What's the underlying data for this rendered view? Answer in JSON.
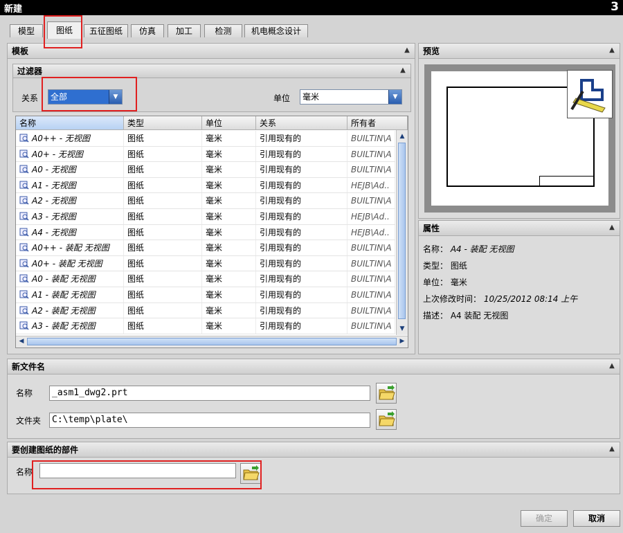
{
  "window": {
    "title": "新建",
    "close_label": "3"
  },
  "tabs": [
    {
      "label": "模型"
    },
    {
      "label": "图纸"
    },
    {
      "label": "五征图纸"
    },
    {
      "label": "仿真"
    },
    {
      "label": "加工"
    },
    {
      "label": "检测"
    },
    {
      "label": "机电概念设计"
    }
  ],
  "template_panel": {
    "title": "模板"
  },
  "filter": {
    "title": "过滤器",
    "relation_label": "关系",
    "relation_value": "全部",
    "unit_label": "单位",
    "unit_value": "毫米"
  },
  "table": {
    "columns": [
      "名称",
      "类型",
      "单位",
      "关系",
      "所有者"
    ],
    "rows": [
      {
        "name": "A0++ - 无视图",
        "type": "图纸",
        "unit": "毫米",
        "relation": "引用现有的",
        "owner": "BUILTIN\\A"
      },
      {
        "name": "A0+ - 无视图",
        "type": "图纸",
        "unit": "毫米",
        "relation": "引用现有的",
        "owner": "BUILTIN\\A"
      },
      {
        "name": "A0 - 无视图",
        "type": "图纸",
        "unit": "毫米",
        "relation": "引用现有的",
        "owner": "BUILTIN\\A"
      },
      {
        "name": "A1 - 无视图",
        "type": "图纸",
        "unit": "毫米",
        "relation": "引用现有的",
        "owner": "HEJB\\Ad.."
      },
      {
        "name": "A2 - 无视图",
        "type": "图纸",
        "unit": "毫米",
        "relation": "引用现有的",
        "owner": "BUILTIN\\A"
      },
      {
        "name": "A3 - 无视图",
        "type": "图纸",
        "unit": "毫米",
        "relation": "引用现有的",
        "owner": "HEJB\\Ad.."
      },
      {
        "name": "A4 - 无视图",
        "type": "图纸",
        "unit": "毫米",
        "relation": "引用现有的",
        "owner": "HEJB\\Ad.."
      },
      {
        "name": "A0++ - 装配 无视图",
        "type": "图纸",
        "unit": "毫米",
        "relation": "引用现有的",
        "owner": "BUILTIN\\A"
      },
      {
        "name": "A0+ - 装配 无视图",
        "type": "图纸",
        "unit": "毫米",
        "relation": "引用现有的",
        "owner": "BUILTIN\\A"
      },
      {
        "name": "A0 - 装配 无视图",
        "type": "图纸",
        "unit": "毫米",
        "relation": "引用现有的",
        "owner": "BUILTIN\\A"
      },
      {
        "name": "A1 - 装配 无视图",
        "type": "图纸",
        "unit": "毫米",
        "relation": "引用现有的",
        "owner": "BUILTIN\\A"
      },
      {
        "name": "A2 - 装配 无视图",
        "type": "图纸",
        "unit": "毫米",
        "relation": "引用现有的",
        "owner": "BUILTIN\\A"
      },
      {
        "name": "A3 - 装配 无视图",
        "type": "图纸",
        "unit": "毫米",
        "relation": "引用现有的",
        "owner": "BUILTIN\\A"
      }
    ]
  },
  "preview_panel": {
    "title": "预览"
  },
  "properties_panel": {
    "title": "属性",
    "items": [
      {
        "label": "名称：",
        "value": "A4 - 装配 无视图"
      },
      {
        "label": "类型：",
        "value": "图纸"
      },
      {
        "label": "单位：",
        "value": "毫米"
      },
      {
        "label": "上次修改时间：",
        "value": "10/25/2012 08:14 上午"
      },
      {
        "label": "描述：",
        "value": "A4 装配 无视图"
      }
    ]
  },
  "new_file_panel": {
    "title": "新文件名",
    "name_label": "名称",
    "name_value": "_asm1_dwg2.prt",
    "folder_label": "文件夹",
    "folder_value": "C:\\temp\\plate\\"
  },
  "part_panel": {
    "title": "要创建图纸的部件",
    "name_label": "名称",
    "name_value": ""
  },
  "buttons": {
    "ok": "确定",
    "cancel": "取消"
  }
}
